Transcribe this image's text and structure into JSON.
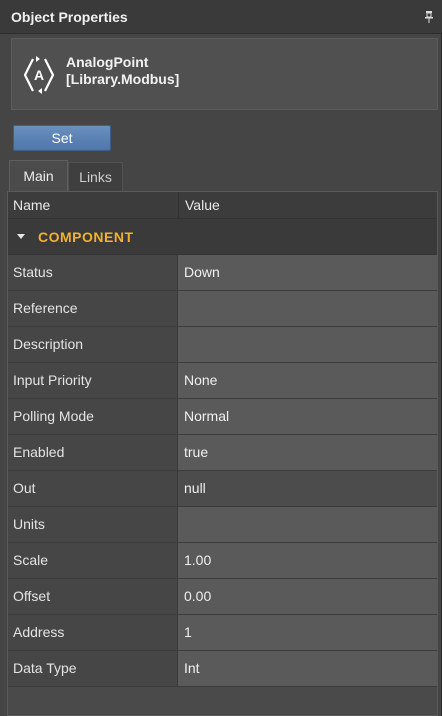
{
  "panel": {
    "title": "Object Properties",
    "pin_icon": "pin-icon"
  },
  "component": {
    "icon": "analog-point-icon",
    "icon_letter": "A",
    "name_line1": "AnalogPoint",
    "name_line2": "[Library.Modbus]"
  },
  "toolbar": {
    "set_label": "Set"
  },
  "tabs": [
    {
      "label": "Main",
      "active": true
    },
    {
      "label": "Links",
      "active": false
    }
  ],
  "grid": {
    "col_name": "Name",
    "col_value": "Value",
    "category": "COMPONENT",
    "rows": [
      {
        "name": "Status",
        "value": "Down"
      },
      {
        "name": "Reference",
        "value": ""
      },
      {
        "name": "Description",
        "value": ""
      },
      {
        "name": "Input Priority",
        "value": "None"
      },
      {
        "name": "Polling Mode",
        "value": "Normal"
      },
      {
        "name": "Enabled",
        "value": "true"
      },
      {
        "name": "Out",
        "value": "null"
      },
      {
        "name": "Units",
        "value": ""
      },
      {
        "name": "Scale",
        "value": "1.00"
      },
      {
        "name": "Offset",
        "value": "0.00"
      },
      {
        "name": "Address",
        "value": "1"
      },
      {
        "name": "Data Type",
        "value": "Int"
      }
    ]
  },
  "colors": {
    "accent": "#f2b12f",
    "button": "#5b82b5"
  }
}
